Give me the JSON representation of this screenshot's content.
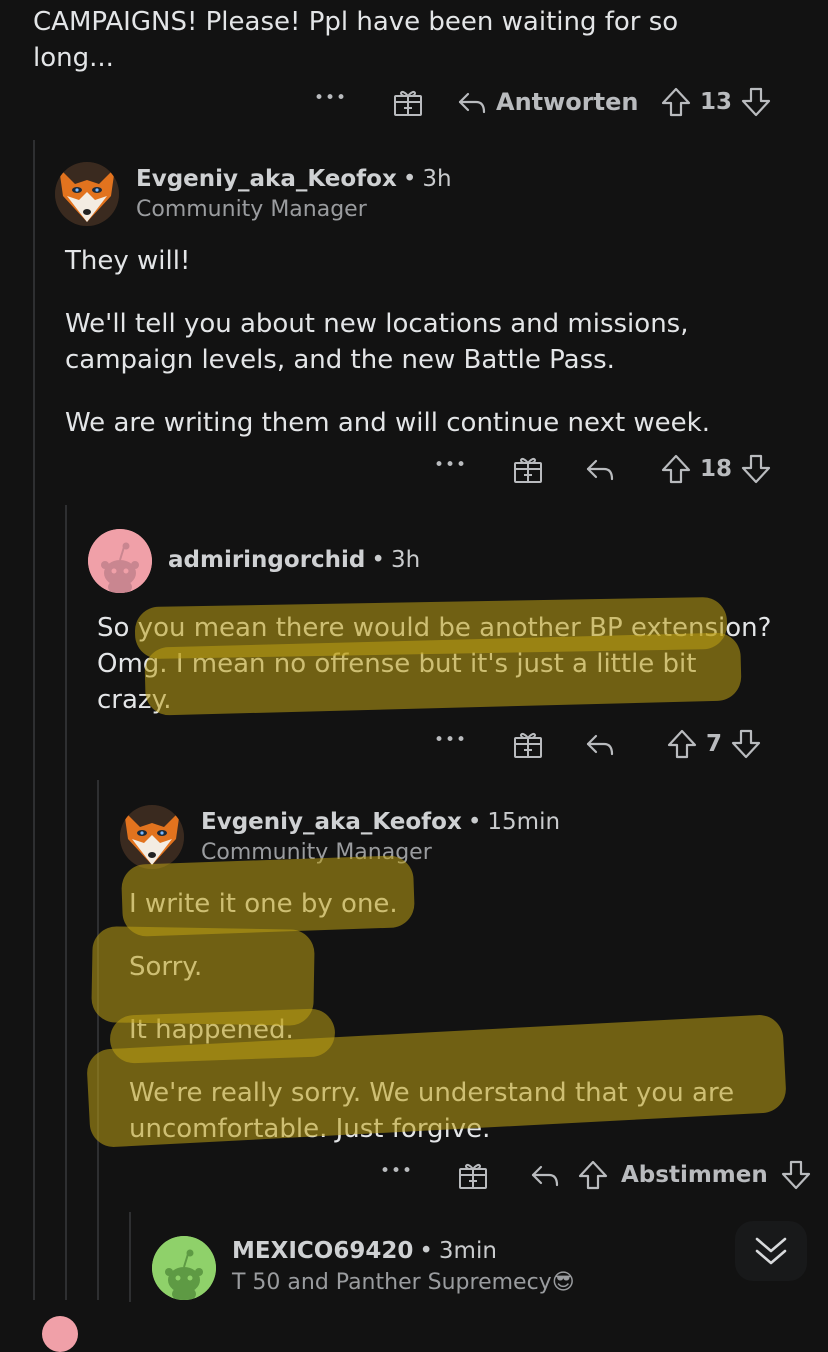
{
  "comments": [
    {
      "id": "top",
      "body": [
        "CAMPAIGNS! Please! Ppl have been waiting for so long..."
      ],
      "actions": {
        "more_label": "•••",
        "reply_label": "Antworten",
        "score": "13"
      }
    },
    {
      "id": "c1",
      "author": "Evgeniy_aka_Keofox",
      "time": "3h",
      "flair": "Community Manager",
      "body": [
        "They will!",
        "We'll tell you about new locations and missions, campaign levels, and the new Battle Pass.",
        "We are writing them and will continue next week."
      ],
      "actions": {
        "more_label": "•••",
        "score": "18"
      }
    },
    {
      "id": "c2",
      "author": "admiringorchid",
      "time": "3h",
      "body": [
        "So you mean there would be another BP extension? Omg. I mean no offense but it's just a little bit crazy."
      ],
      "actions": {
        "more_label": "•••",
        "score": "7"
      }
    },
    {
      "id": "c3",
      "author": "Evgeniy_aka_Keofox",
      "time": "15min",
      "flair": "Community Manager",
      "body": [
        "I write it one by one.",
        "Sorry.",
        "It happened.",
        "We're really sorry. We understand that you are uncomfortable. Just forgive."
      ],
      "actions": {
        "more_label": "•••",
        "vote_label": "Abstimmen"
      }
    },
    {
      "id": "c4",
      "author": "MEXICO69420",
      "time": "3min",
      "flair": "T 50 and Panther Supremecy",
      "flair_emoji": "😎"
    }
  ],
  "separator": "•",
  "icons": [
    "more-icon",
    "award-icon",
    "reply-icon",
    "upvote-icon",
    "downvote-icon",
    "collapse-chevrons-icon"
  ],
  "colors": {
    "background": "#121212",
    "thread_line": "#2e2f31",
    "highlight": "#bea014",
    "avatar_pink": "#f0a0a8",
    "avatar_green": "#8fd16a"
  }
}
